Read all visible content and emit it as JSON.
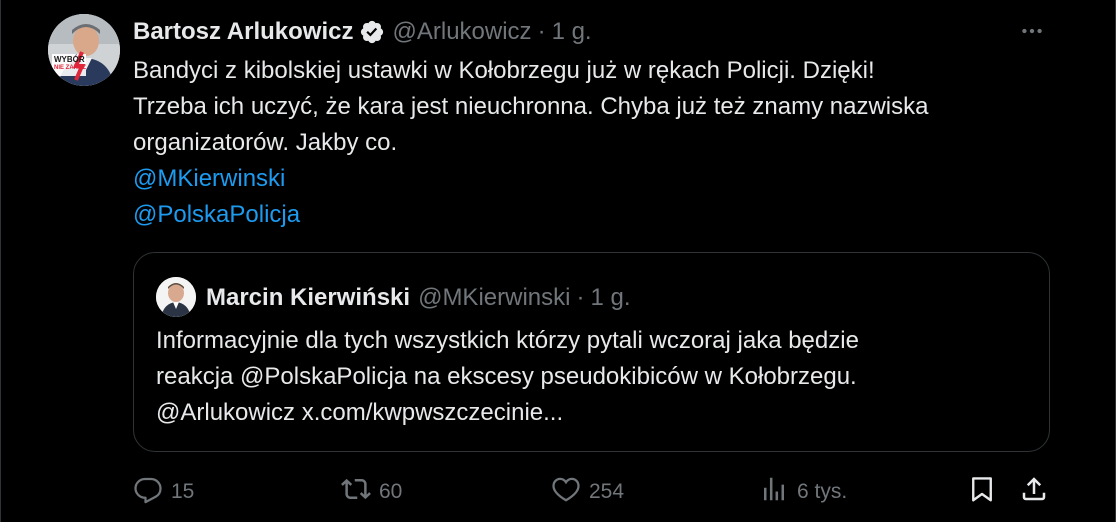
{
  "author": {
    "name": "Bartosz Arlukowicz",
    "handle": "@Arlukowicz",
    "separator": "·",
    "time": "1 g.",
    "avatar_caption_line1": "WYBÓR",
    "avatar_caption_line2": "NIE ZAKAZ"
  },
  "tweet": {
    "lines": [
      "Bandyci z kibolskiej ustawki w Kołobrzegu już w rękach Policji. Dzięki!",
      "Trzeba ich uczyć, że kara jest nieuchronna. Chyba już też znamy nazwiska",
      "organizatorów. Jakby co."
    ],
    "mentions": [
      "@MKierwinski",
      "@PolskaPolicja"
    ]
  },
  "quote": {
    "name": "Marcin Kierwiński",
    "handle": "@MKierwinski",
    "separator": "·",
    "time": "1 g.",
    "lines": [
      "Informacyjnie dla tych wszystkich którzy pytali wczoraj jaka będzie",
      "reakcja @PolskaPolicja na ekscesy pseudokibiców w Kołobrzegu.",
      "@Arlukowicz x.com/kwpwszczecinie..."
    ]
  },
  "actions": {
    "replies": "15",
    "reposts": "60",
    "likes": "254",
    "views": "6 tys."
  },
  "colors": {
    "background": "#000000",
    "text": "#e7e9ea",
    "secondary": "#71767b",
    "link": "#1d9bf0",
    "border": "#2f3336"
  },
  "icons": [
    "verified-badge-icon",
    "more-icon",
    "reply-icon",
    "repost-icon",
    "like-icon",
    "views-icon",
    "bookmark-icon",
    "share-icon"
  ]
}
